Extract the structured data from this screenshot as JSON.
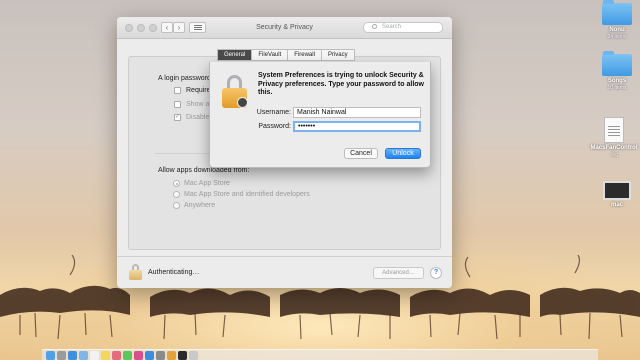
{
  "desktop": {
    "icons": [
      {
        "name": "Nonu",
        "sub": "24 items",
        "kind": "folder"
      },
      {
        "name": "Songs",
        "sub": "10 items",
        "kind": "folder"
      },
      {
        "name": "MacsFanControl",
        "sub": ".log",
        "kind": "document"
      },
      {
        "name": "mac",
        "sub": "",
        "kind": "screenshot"
      }
    ]
  },
  "window": {
    "title": "Security & Privacy",
    "search_placeholder": "Search",
    "nav_back": "‹",
    "nav_forward": "›",
    "tabs": [
      "General",
      "FileVault",
      "Firewall",
      "Privacy"
    ],
    "general": {
      "login_password_label": "A login password",
      "require_password_label": "Require p",
      "show_message_label": "Show a m",
      "disable_auto_login_label": "Disable a",
      "disable_auto_login_checked": "✓",
      "allow_apps_label": "Allow apps downloaded from:",
      "options": [
        "Mac App Store",
        "Mac App Store and identified developers",
        "Anywhere"
      ],
      "selected_option": "Mac App Store"
    },
    "status_text": "Authenticating…",
    "advanced_label": "Advanced…",
    "help_label": "?"
  },
  "auth_dialog": {
    "message": "System Preferences is trying to unlock Security & Privacy preferences. Type your password to allow this.",
    "username_label": "Username:",
    "username_value": "Manish Nainwal",
    "password_label": "Password:",
    "password_value": "•••••••",
    "cancel_label": "Cancel",
    "unlock_label": "Unlock"
  },
  "colors": {
    "accent": "#1a82f0",
    "lock": "#e39b2a",
    "folder": "#3f9ae4"
  }
}
